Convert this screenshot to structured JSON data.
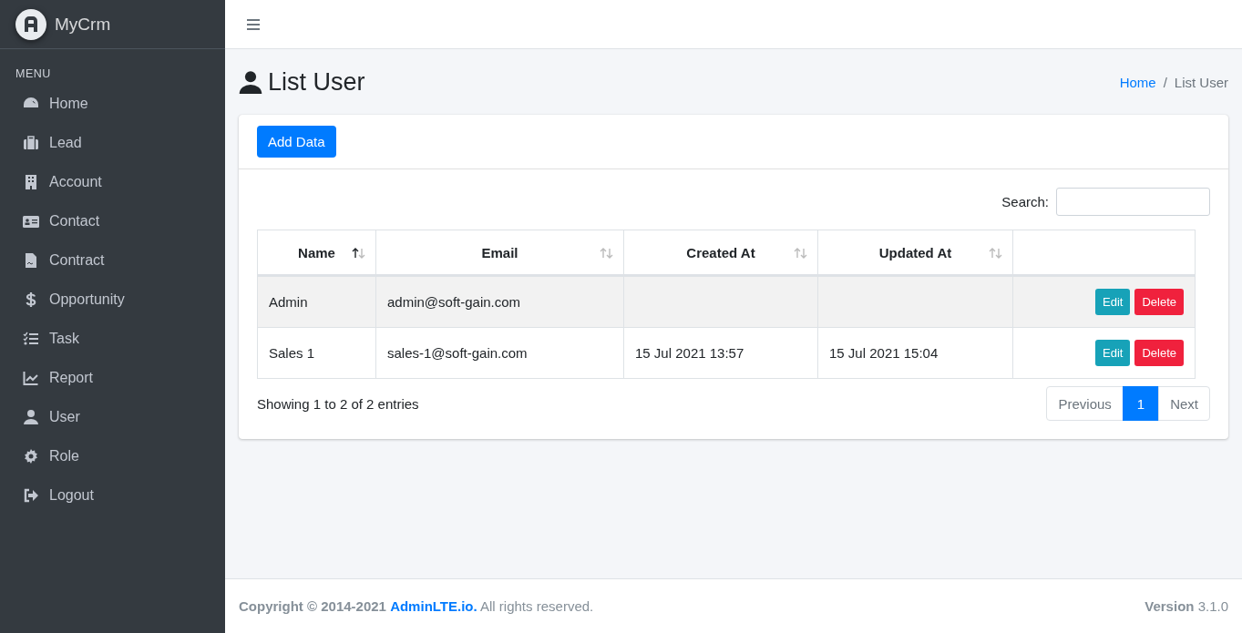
{
  "brand": {
    "name": "MyCrm"
  },
  "sidebar": {
    "header": "MENU",
    "items": [
      {
        "label": "Home",
        "selected": false
      },
      {
        "label": "Lead",
        "selected": false
      },
      {
        "label": "Account",
        "selected": false
      },
      {
        "label": "Contact",
        "selected": false
      },
      {
        "label": "Contract",
        "selected": false
      },
      {
        "label": "Opportunity",
        "selected": false
      },
      {
        "label": "Task",
        "selected": false
      },
      {
        "label": "Report",
        "selected": false
      },
      {
        "label": "User",
        "selected": false
      },
      {
        "label": "Role",
        "selected": false
      },
      {
        "label": "Logout",
        "selected": false
      }
    ]
  },
  "page": {
    "title": "List User",
    "breadcrumb": [
      {
        "label": "Home",
        "kind": "link"
      },
      {
        "label": "/",
        "kind": "separator"
      },
      {
        "label": "List User",
        "kind": "current"
      }
    ]
  },
  "card": {
    "add_button": "Add Data",
    "search": {
      "label": "Search:"
    },
    "table": {
      "columns": [
        {
          "label": "Name",
          "sorted": true
        },
        {
          "label": "Email",
          "sorted": false
        },
        {
          "label": "Created At",
          "sorted": false
        },
        {
          "label": "Updated At",
          "sorted": false
        }
      ],
      "rows": [
        {
          "cells": [
            "Admin",
            "admin@soft-gain.com",
            "",
            ""
          ],
          "actions": [
            "Edit",
            "Delete"
          ]
        },
        {
          "cells": [
            "Sales 1",
            "sales-1@soft-gain.com",
            "15 Jul 2021 13:57",
            "15 Jul 2021 15:04"
          ],
          "actions": [
            "Edit",
            "Delete"
          ]
        }
      ]
    },
    "info": "Showing 1 to 2 of 2 entries",
    "pagination": [
      {
        "label": "Previous",
        "kind": "nav",
        "selected": false
      },
      {
        "label": "1",
        "kind": "page",
        "selected": true
      },
      {
        "label": "Next",
        "kind": "nav",
        "selected": false
      }
    ]
  },
  "footer": {
    "copyright": "Copyright © 2014-2021",
    "link": "AdminLTE.io.",
    "rights": "All rights reserved.",
    "version": "**Version** 3.1.0"
  }
}
